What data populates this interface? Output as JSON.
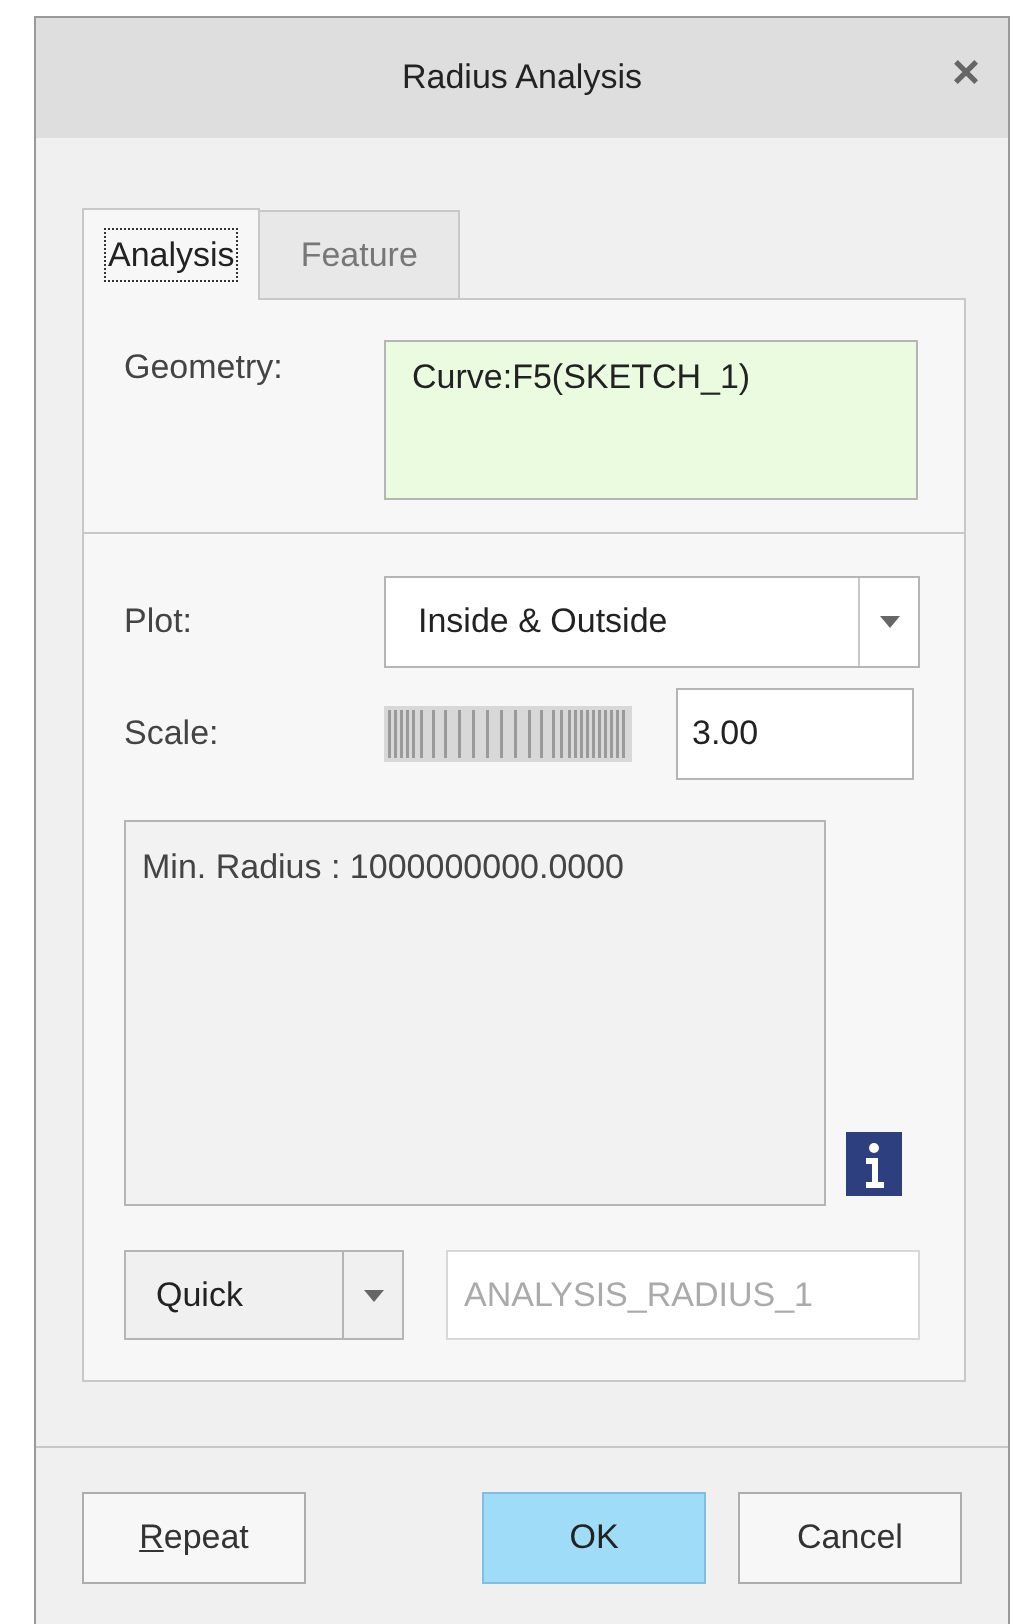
{
  "window": {
    "title": "Radius Analysis",
    "close": "×"
  },
  "tabs": [
    {
      "label": "Analysis",
      "selected": true
    },
    {
      "label": "Feature",
      "selected": false
    }
  ],
  "geometry": {
    "label": "Geometry:",
    "value": "Curve:F5(SKETCH_1)"
  },
  "plot": {
    "label": "Plot:",
    "value": "Inside & Outside"
  },
  "scale": {
    "label": "Scale:",
    "value": "3.00"
  },
  "result": {
    "text": "Min. Radius : 1000000000.0000"
  },
  "mode": {
    "value": "Quick"
  },
  "name_field": {
    "value": "ANALYSIS_RADIUS_1",
    "disabled": true
  },
  "buttons": [
    {
      "label": "Repeat",
      "mnemonic": true,
      "default": false
    },
    {
      "label": "OK",
      "mnemonic": false,
      "default": true
    },
    {
      "label": "Cancel",
      "mnemonic": false,
      "default": false
    }
  ]
}
